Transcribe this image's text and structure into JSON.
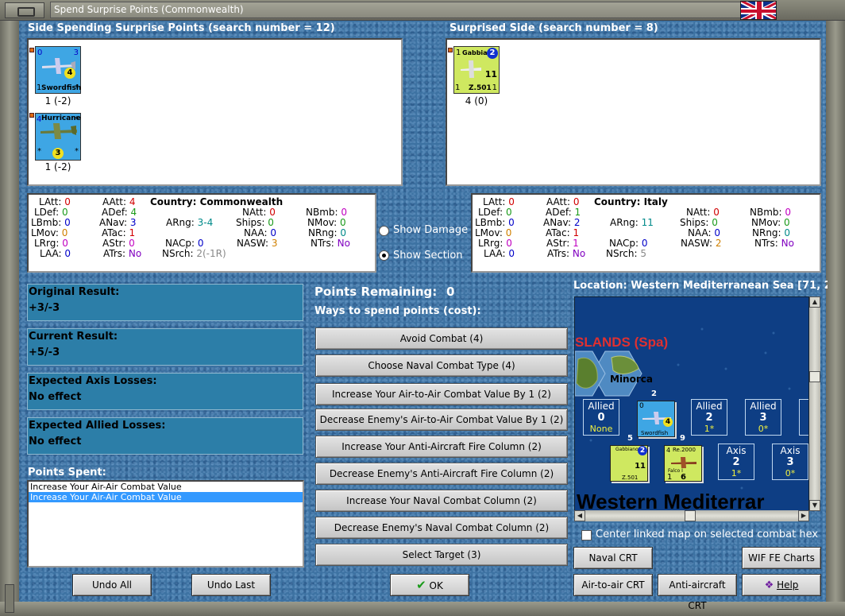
{
  "window": {
    "title": "Spend Surprise Points (Commonwealth)",
    "flag_icon": "uk-flag-icon"
  },
  "left_side": {
    "header": "Side Spending Surprise Points (search number = 12)",
    "units": [
      {
        "name": "Swordfish",
        "top_left": "0",
        "top_right": "3",
        "circle": "4",
        "bottom_left": "1",
        "bottom_right": "*",
        "caption": "1 (-2)"
      },
      {
        "name": "Hurricane",
        "top_left": "4",
        "top_right": "*",
        "circle": "3",
        "bottom_left": "*",
        "bottom_right": "*",
        "caption": "1 (-2)"
      }
    ]
  },
  "right_side": {
    "header": "Surprised Side (search number = 8)",
    "units": [
      {
        "name": "Gabbiano",
        "top_left": "1",
        "circle": "2",
        "mid": "11",
        "model": "Z.501",
        "bottom_left": "1",
        "bottom_right": "1",
        "caption": "4 (0)"
      }
    ]
  },
  "stats_left": {
    "country_label": "Country:",
    "country": "Commonwealth",
    "latt_l": "LAtt:",
    "latt": "0",
    "ldef_l": "LDef:",
    "ldef": "0",
    "lbmb_l": "LBmb:",
    "lbmb": "0",
    "lmov_l": "LMov:",
    "lmov": "0",
    "lrng_l": "LRrg:",
    "lrng": "0",
    "laa_l": "LAA:",
    "laa": "0",
    "aatt_l": "AAtt:",
    "aatt": "4",
    "adef_l": "ADef:",
    "adef": "4",
    "anav_l": "ANav:",
    "anav": "3",
    "atac_l": "ATac:",
    "atac": "1",
    "astr_l": "AStr:",
    "astr": "0",
    "atrs_l": "ATrs:",
    "atrs": "No",
    "arng_l": "ARng:",
    "arng": "3-4",
    "nacp_l": "NACp:",
    "nacp": "0",
    "nsrch_l": "NSrch:",
    "nsrch": "2(-1R)",
    "natt_l": "NAtt:",
    "natt": "0",
    "ships_l": "Ships:",
    "ships": "0",
    "naa_l": "NAA:",
    "naa": "0",
    "nasw_l": "NASW:",
    "nasw": "3",
    "nbmb_l": "NBmb:",
    "nbmb": "0",
    "nmov_l": "NMov:",
    "nmov": "0",
    "nrng_l": "NRng:",
    "nrng": "0",
    "ntrs_l": "NTrs:",
    "ntrs": "No"
  },
  "stats_right": {
    "country_label": "Country:",
    "country": "Italy",
    "latt_l": "LAtt:",
    "latt": "0",
    "ldef_l": "LDef:",
    "ldef": "0",
    "lbmb_l": "LBmb:",
    "lbmb": "0",
    "lmov_l": "LMov:",
    "lmov": "0",
    "lrng_l": "LRrg:",
    "lrng": "0",
    "laa_l": "LAA:",
    "laa": "0",
    "aatt_l": "AAtt:",
    "aatt": "0",
    "adef_l": "ADef:",
    "adef": "1",
    "anav_l": "ANav:",
    "anav": "2",
    "atac_l": "ATac:",
    "atac": "1",
    "astr_l": "AStr:",
    "astr": "1",
    "atrs_l": "ATrs:",
    "atrs": "No",
    "arng_l": "ARng:",
    "arng": "11",
    "nacp_l": "NACp:",
    "nacp": "0",
    "nsrch_l": "NSrch:",
    "nsrch": "5",
    "natt_l": "NAtt:",
    "natt": "0",
    "ships_l": "Ships:",
    "ships": "0",
    "naa_l": "NAA:",
    "naa": "0",
    "nasw_l": "NASW:",
    "nasw": "2",
    "nbmb_l": "NBmb:",
    "nbmb": "0",
    "nmov_l": "NMov:",
    "nmov": "0",
    "nrng_l": "NRng:",
    "nrng": "0",
    "ntrs_l": "NTrs:",
    "ntrs": "No"
  },
  "options": {
    "show_damage": "Show Damage",
    "show_section": "Show Section",
    "selected": "show_section"
  },
  "results": {
    "original_label": "Original Result:",
    "original": "+3/-3",
    "current_label": "Current Result:",
    "current": "+5/-3",
    "axis_label": "Expected Axis Losses:",
    "axis": "No effect",
    "allied_label": "Expected Allied Losses:",
    "allied": "No effect"
  },
  "points_spent": {
    "label": "Points Spent:",
    "items": [
      "Increase Your Air-Air Combat Value",
      "Increase Your Air-Air Combat Value"
    ],
    "selected_index": 1
  },
  "points": {
    "remaining_label": "Points Remaining:",
    "remaining": "0",
    "ways_label": "Ways to spend points (cost):"
  },
  "ways": [
    "Avoid Combat (4)",
    "Choose Naval Combat Type (4)",
    "Increase Your Air-to-Air Combat Value By 1 (2)",
    "Decrease Enemy's Air-to-Air Combat Value By 1 (2)",
    "Increase Your Anti-Aircraft Fire Column (2)",
    "Decrease Enemy's Anti-Aircraft Fire Column (2)",
    "Increase Your Naval Combat Column (2)",
    "Decrease Enemy's Naval Combat Column (2)",
    "Select Target (3)"
  ],
  "buttons": {
    "undo_all": "Undo All",
    "undo_last": "Undo Last",
    "ok": "OK",
    "naval_crt": "Naval CRT",
    "wif_fe_charts": "WIF FE Charts",
    "air_crt": "Air-to-air CRT",
    "aa_crt": "Anti-aircraft CRT",
    "help": "Help"
  },
  "map": {
    "location": "Location: Western Mediterranean Sea [71, 2",
    "islands_label": "SLANDS (Spa)",
    "minorca": "Minorca",
    "sea_name": "Western Mediterrar",
    "allied_boxes": [
      {
        "label": "Allied",
        "num": "0",
        "sub": "None"
      },
      {
        "label": "Allied",
        "num": "2",
        "sub": "1*"
      },
      {
        "label": "Allied",
        "num": "3",
        "sub": "0*"
      }
    ],
    "axis_boxes": [
      {
        "label": "Axis",
        "num": "2",
        "sub": "1*"
      },
      {
        "label": "Axis",
        "num": "3",
        "sub": "0*"
      }
    ],
    "counters": {
      "swordfish": {
        "name": "Swordfish",
        "stack": "2",
        "tl": "0",
        "circle": "4"
      },
      "gabbiano": {
        "name": "Gabbiano",
        "stack": "5",
        "circle": "2",
        "mid": "11",
        "model": "Z.501"
      },
      "re2000": {
        "name": "Re.2000",
        "stack": "9",
        "tl": "4",
        "sub": "Falco I",
        "bl": "1",
        "br": "6"
      }
    },
    "center_linked": "Center linked map on selected combat hex"
  }
}
